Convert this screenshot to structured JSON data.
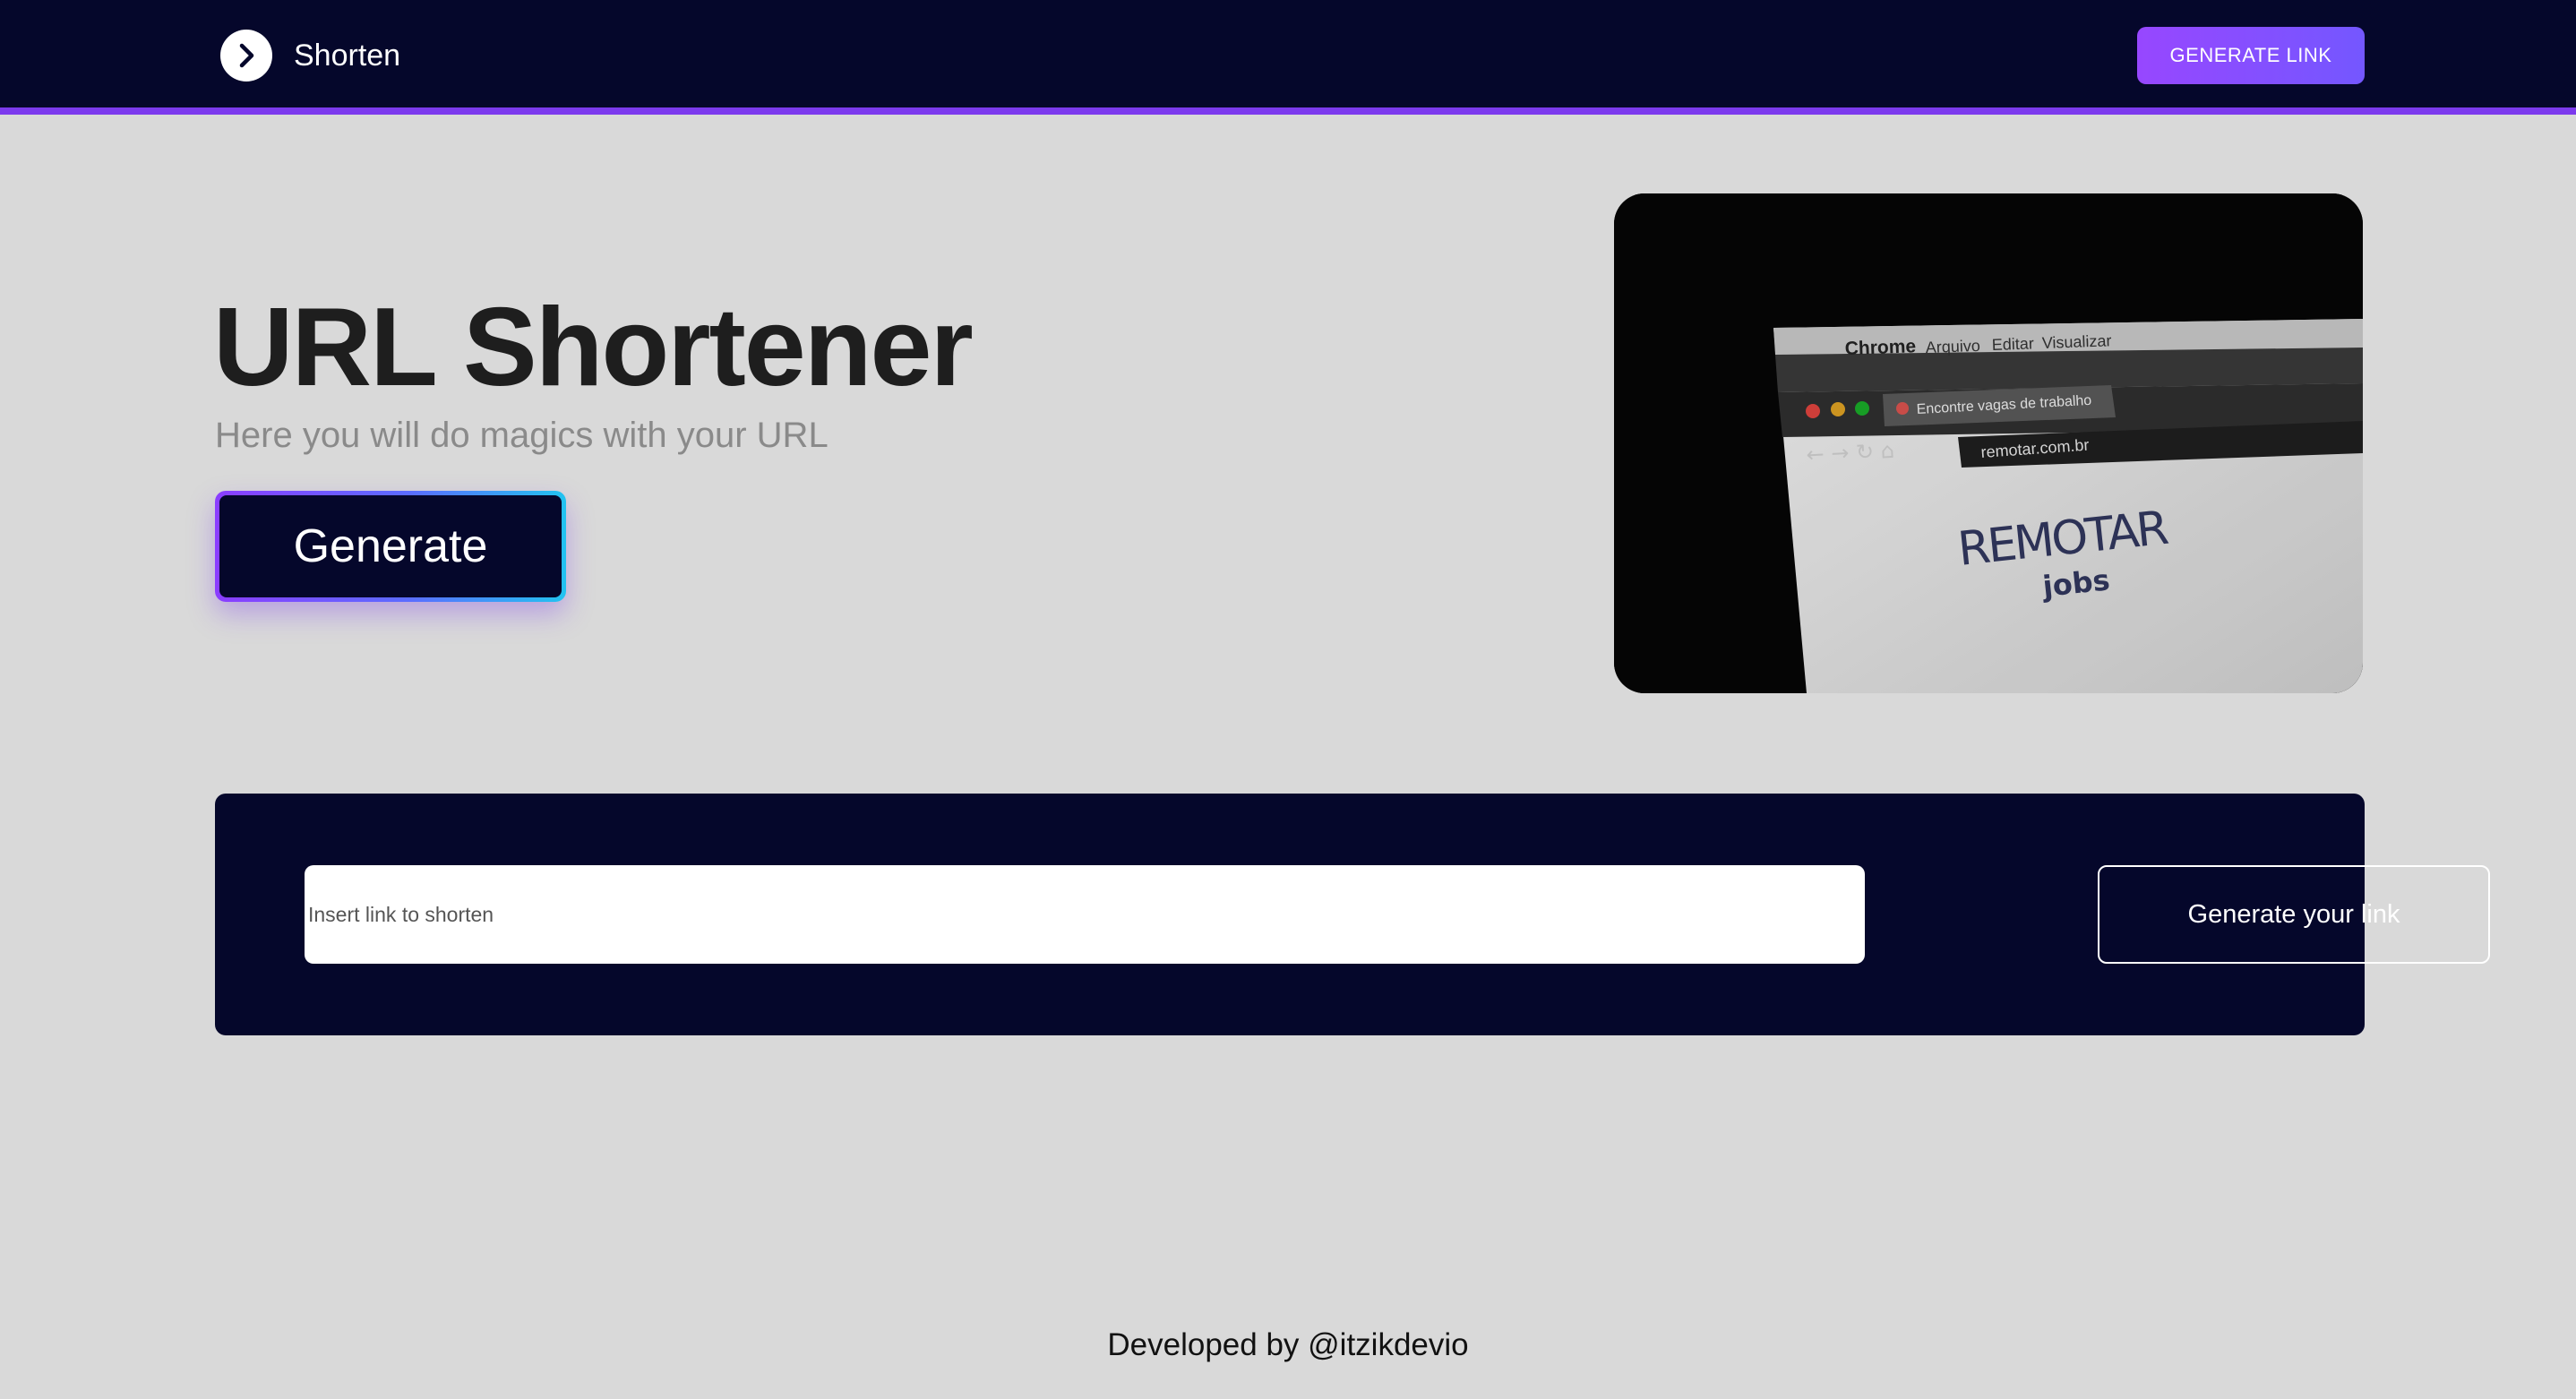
{
  "navbar": {
    "brand_name": "Shorten",
    "brand_icon": "chevron-right-circle-icon",
    "cta_label": "GENERATE LINK",
    "accent_color": "#7c3aed"
  },
  "hero": {
    "title": "URL Shortener",
    "subtitle": "Here you will do magics with your URL",
    "button_label": "Generate",
    "image": {
      "menu_app": "Chrome",
      "menu_items": [
        "Arquivo",
        "Editar",
        "Visualizar"
      ],
      "tab_title": "Encontre vagas de trabalho",
      "address": "remotar.com.br",
      "logo_main": "REMOTAR",
      "logo_sub": "jobs"
    }
  },
  "shorten_form": {
    "input_placeholder": "Insert link to shorten",
    "input_value": "",
    "submit_label": "Generate your link"
  },
  "footer": {
    "text": "Developed by @itzikdevio"
  },
  "colors": {
    "background": "#d9d9d9",
    "navy": "#05072b",
    "purple": "#9747ff",
    "cyan": "#22c3f0"
  }
}
